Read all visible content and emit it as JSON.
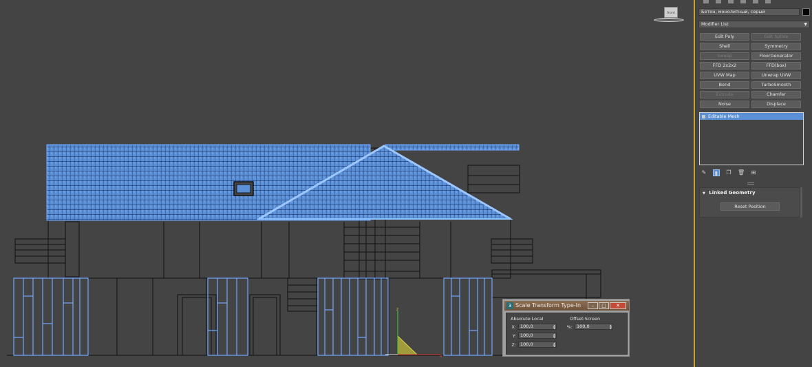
{
  "viewport": {
    "viewcube_label": "front"
  },
  "command_panel": {
    "object_name": "Бетон, монолитный, серый",
    "object_color": "#050505",
    "modifier_list_label": "Modifier List",
    "modifier_buttons": [
      {
        "label": "Edit Poly",
        "enabled": true
      },
      {
        "label": "Edit Spline",
        "enabled": false
      },
      {
        "label": "Shell",
        "enabled": true
      },
      {
        "label": "Symmetry",
        "enabled": true
      },
      {
        "label": "Sweep",
        "enabled": false
      },
      {
        "label": "FloorGenerator",
        "enabled": true
      },
      {
        "label": "FFD 2x2x2",
        "enabled": true
      },
      {
        "label": "FFD(box)",
        "enabled": true
      },
      {
        "label": "UVW Map",
        "enabled": true
      },
      {
        "label": "Unwrap UVW",
        "enabled": true
      },
      {
        "label": "Bend",
        "enabled": true
      },
      {
        "label": "TurboSmooth",
        "enabled": true
      },
      {
        "label": "Extrude",
        "enabled": false
      },
      {
        "label": "Chamfer",
        "enabled": true
      },
      {
        "label": "Noise",
        "enabled": true
      },
      {
        "label": "Displace",
        "enabled": true
      }
    ],
    "modifier_stack": [
      "Editable Mesh"
    ],
    "rollout_title": "Linked Geometry",
    "reset_position_label": "Reset Position"
  },
  "dialog": {
    "title": "Scale Transform Type-In",
    "absolute_title": "Absolute:Local",
    "offset_title": "Offset:Screen",
    "absolute": [
      {
        "axis": "X:",
        "value": "100,0"
      },
      {
        "axis": "Y:",
        "value": "100,0"
      },
      {
        "axis": "Z:",
        "value": "100,0"
      }
    ],
    "offset": {
      "axis": "%:",
      "value": "100,0"
    }
  },
  "colors": {
    "background": "#444444",
    "selected_wire": "#6fa8ff",
    "roof_fill": "#5b8fd6",
    "wire": "#111111",
    "viewport_border": "#c9a227",
    "dialog_title": "#7a5e46"
  }
}
